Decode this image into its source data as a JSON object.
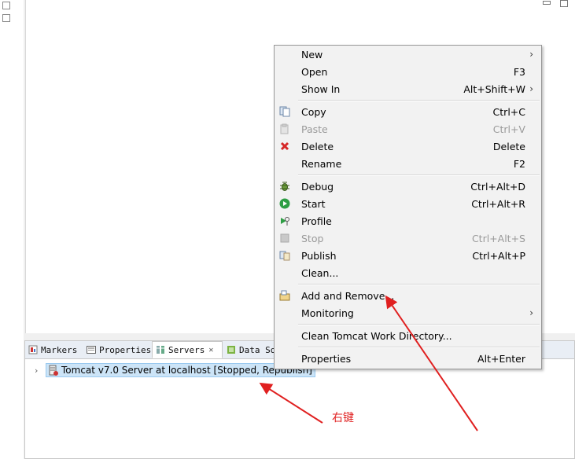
{
  "tabs": [
    {
      "label": "Markers",
      "icon": "markers-icon"
    },
    {
      "label": "Properties",
      "icon": "properties-icon"
    },
    {
      "label": "Servers",
      "icon": "servers-icon",
      "close": "✕"
    },
    {
      "label": "Data So",
      "icon": "data-source-icon"
    }
  ],
  "server_row": {
    "label": "Tomcat v7.0 Server at localhost  [Stopped, Republish]",
    "chevron": "›"
  },
  "menu": {
    "new": {
      "label": "New",
      "arrow": "›"
    },
    "open": {
      "label": "Open",
      "shortcut": "F3"
    },
    "show_in": {
      "label": "Show In",
      "shortcut": "Alt+Shift+W",
      "arrow": "›"
    },
    "copy": {
      "label": "Copy",
      "shortcut": "Ctrl+C"
    },
    "paste": {
      "label": "Paste",
      "shortcut": "Ctrl+V"
    },
    "delete": {
      "label": "Delete",
      "shortcut": "Delete"
    },
    "rename": {
      "label": "Rename",
      "shortcut": "F2"
    },
    "debug": {
      "label": "Debug",
      "shortcut": "Ctrl+Alt+D"
    },
    "start": {
      "label": "Start",
      "shortcut": "Ctrl+Alt+R"
    },
    "profile": {
      "label": "Profile"
    },
    "stop": {
      "label": "Stop",
      "shortcut": "Ctrl+Alt+S"
    },
    "publish": {
      "label": "Publish",
      "shortcut": "Ctrl+Alt+P"
    },
    "clean": {
      "label": "Clean..."
    },
    "add_remove": {
      "label": "Add and Remove..."
    },
    "monitoring": {
      "label": "Monitoring",
      "arrow": "›"
    },
    "clean_tomcat": {
      "label": "Clean Tomcat Work Directory..."
    },
    "properties": {
      "label": "Properties",
      "shortcut": "Alt+Enter"
    }
  },
  "annotation": {
    "text": "右键",
    "color": "#e02020"
  }
}
